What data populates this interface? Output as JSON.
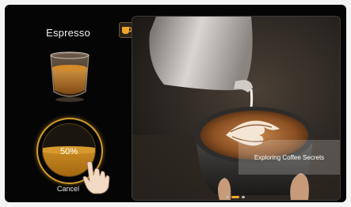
{
  "product": {
    "name": "Espresso"
  },
  "brew": {
    "progress_percent": 50,
    "progress_label": "50%",
    "cancel_label": "Cancel"
  },
  "media": {
    "caption": "Exploring Coffee Secrets",
    "slide_count": 3,
    "active_slide": 1
  },
  "colors": {
    "accent": "#d39a2b",
    "background": "#050505",
    "dot_active": "#f0a52a"
  },
  "icons": {
    "media_badge": "coffee-cup-icon",
    "touch": "hand-pointer-icon"
  }
}
